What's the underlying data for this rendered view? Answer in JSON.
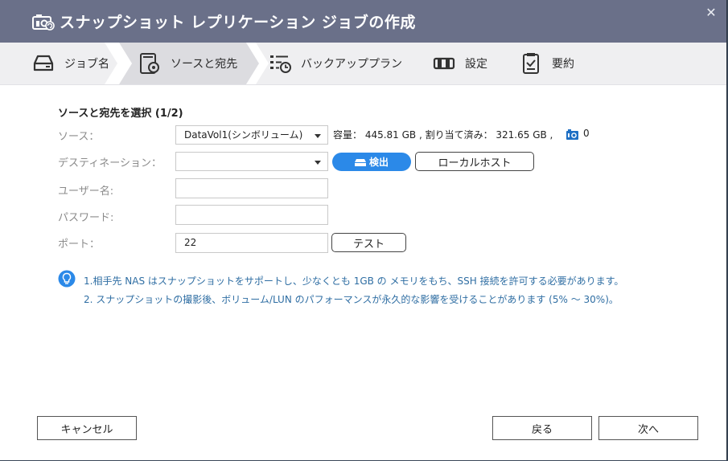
{
  "dialog": {
    "title": "スナップショット レプリケーション ジョブの作成",
    "close_glyph": "✕"
  },
  "steps": [
    {
      "label": "ジョブ名",
      "icon": "hdd-icon"
    },
    {
      "label": "ソースと宛先",
      "icon": "disk-gear-icon",
      "active": true
    },
    {
      "label": "バックアッププラン",
      "icon": "schedule-list-icon"
    },
    {
      "label": "設定",
      "icon": "settings-bar-icon"
    },
    {
      "label": "要約",
      "icon": "clipboard-check-icon"
    }
  ],
  "form": {
    "section_title": "ソースと宛先を選択 (1/2)",
    "source_label": "ソース：",
    "source_value": "DataVol1(シンボリューム)",
    "capacity_text": "容量： 445.81 GB , 割り当て済み： 321.65 GB ,",
    "snapshot_count": "0",
    "destination_label": "デスティネーション：",
    "destination_value": "",
    "detect_button": "検出",
    "localhost_button": "ローカルホスト",
    "username_label": "ユーザー名:",
    "username_value": "",
    "password_label": "パスワード:",
    "password_value": "",
    "port_label": "ポート：",
    "port_value": "22",
    "test_button": "テスト"
  },
  "notes": [
    "1.相手先 NAS はスナップショットをサポートし、少なくとも 1GB の メモリをもち、SSH 接続を許可する必要があります。",
    "2. スナップショットの撮影後、ボリューム/LUN のパフォーマンスが永久的な影響を受けることがあります (5% ～ 30%)。"
  ],
  "footer": {
    "cancel": "キャンセル",
    "back": "戻る",
    "next": "次へ"
  },
  "colors": {
    "titlebar": "#6a7089",
    "accent": "#2b89e8",
    "note_text": "#2f6ea3",
    "stepbar": "#efeff1"
  }
}
